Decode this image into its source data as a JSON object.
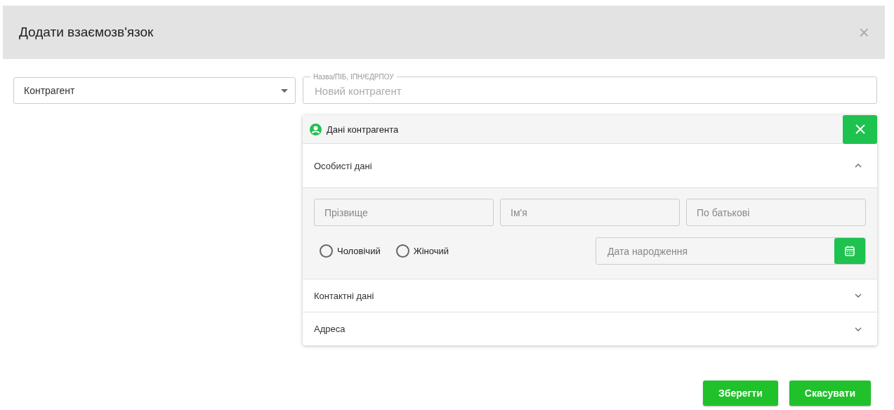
{
  "dialog": {
    "title": "Додати взаємозв'язок",
    "close": "×"
  },
  "type_select": {
    "value": "Контрагент"
  },
  "name_field": {
    "label": "Назва/ПІБ, ІПН/ЄДРПОУ",
    "placeholder": "Новий контрагент"
  },
  "panel": {
    "title": "Дані контрагента",
    "sections": [
      {
        "title": "Особисті дані",
        "expanded": true,
        "fields": [
          {
            "placeholder": "Прізвище"
          },
          {
            "placeholder": "Ім'я"
          },
          {
            "placeholder": "По батькові"
          }
        ],
        "gender": [
          {
            "label": "Чоловічий",
            "selected": false
          },
          {
            "label": "Жіночий",
            "selected": false
          }
        ],
        "birth_date": {
          "placeholder": "Дата народження"
        }
      },
      {
        "title": "Контактні дані",
        "expanded": false
      },
      {
        "title": "Адреса",
        "expanded": false
      }
    ]
  },
  "buttons": [
    "Зберегти",
    "Скасувати"
  ]
}
